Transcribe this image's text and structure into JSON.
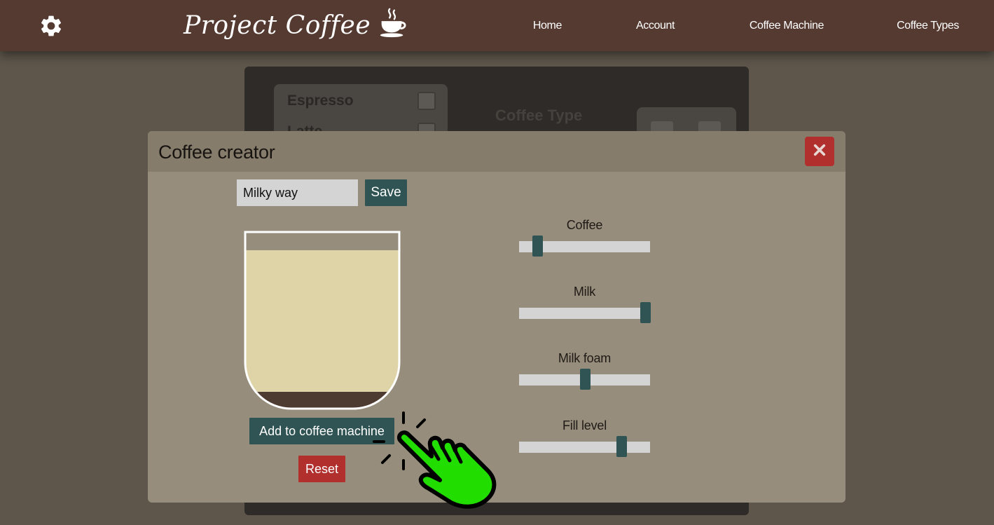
{
  "nav": {
    "brand": "Project Coffee",
    "links": [
      "Home",
      "Account",
      "Coffee Machine",
      "Coffee Types"
    ]
  },
  "background_panel": {
    "items": [
      "Espresso",
      "Latte"
    ],
    "coffee_type_label": "Coffee Type"
  },
  "modal": {
    "title": "Coffee creator",
    "name_value": "Milky way",
    "save_label": "Save",
    "add_label": "Add to coffee machine",
    "reset_label": "Reset",
    "sliders": [
      {
        "label": "Coffee",
        "value_fraction": 0.14
      },
      {
        "label": "Milk",
        "value_fraction": 0.96
      },
      {
        "label": "Milk foam",
        "value_fraction": 0.5
      },
      {
        "label": "Fill level",
        "value_fraction": 0.78
      }
    ]
  },
  "colors": {
    "navbar": "#543a31",
    "modal_body": "#968d7c",
    "modal_header": "#867c6b",
    "teal_button": "#2f5453",
    "red_button": "#b1302e",
    "milk": "#ded4a8",
    "coffee": "#4d3b32",
    "cursor_hand": "#22dd00"
  },
  "icons": {
    "settings": "gear-icon",
    "brand": "coffee-cup-icon",
    "close": "close-icon",
    "cursor": "pointing-hand-icon"
  }
}
